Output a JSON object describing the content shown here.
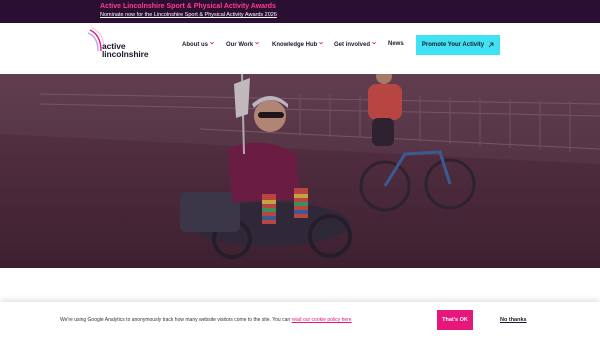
{
  "announcement": {
    "title": "Active Lincolnshire Sport & Physical Activity Awards",
    "link": "Nominate now for the Lincolnshire Sport & Physical Activity Awards 2026"
  },
  "logo": {
    "line1": "active",
    "line2": "lincolnshire"
  },
  "nav": {
    "items": [
      {
        "label": "About us",
        "has_dropdown": true
      },
      {
        "label": "Our Work",
        "has_dropdown": true
      },
      {
        "label": "Knowledge Hub",
        "has_dropdown": true
      },
      {
        "label": "Get involved",
        "has_dropdown": true
      },
      {
        "label": "News",
        "has_dropdown": false
      }
    ],
    "cta": "Promote Your Activity",
    "cta_icon": "arrow-up-right-icon"
  },
  "hero": {
    "alt_subject": "hero-photo"
  },
  "cookie": {
    "message": "We're using Google Analytics to anonymously track how many website visitors come to the site. You can",
    "policy_link": "read our cookie policy here",
    "accept": "That's OK",
    "decline": "No thanks"
  },
  "colors": {
    "announce_bg": "#2a0f33",
    "accent_pink": "#e6167a",
    "cta_cyan": "#3fe1f2"
  }
}
